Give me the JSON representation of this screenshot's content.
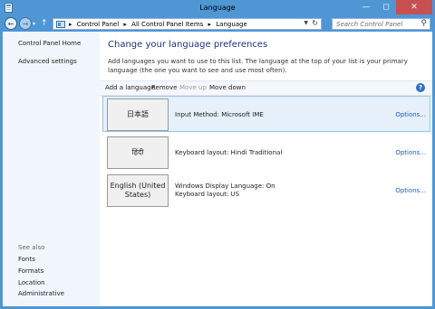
{
  "window": {
    "title": "Language"
  },
  "navigation": {
    "breadcrumbs": [
      "Control Panel",
      "All Control Panel Items",
      "Language"
    ],
    "search_placeholder": "Search Control Panel"
  },
  "sidebar": {
    "links": [
      "Control Panel Home",
      "Advanced settings"
    ],
    "see_also_label": "See also",
    "see_also": [
      "Fonts",
      "Formats",
      "Location",
      "Administrative"
    ]
  },
  "main": {
    "heading": "Change your language preferences",
    "description": "Add languages you want to use to this list. The language at the top of your list is your primary language (the one you want to see and use most often).",
    "toolbar": {
      "add": "Add a language",
      "remove": "Remove",
      "move_up": "Move up",
      "move_down": "Move down",
      "help": "?"
    },
    "languages": [
      {
        "tile": "日本語",
        "details": [
          "Input Method: Microsoft IME"
        ],
        "options": "Options..."
      },
      {
        "tile": "हिंदी",
        "details": [
          "Keyboard layout: Hindi Traditional"
        ],
        "options": "Options..."
      },
      {
        "tile": "English (United States)",
        "details": [
          "Windows Display Language: On",
          "Keyboard layout: US"
        ],
        "options": "Options..."
      }
    ]
  },
  "colors": {
    "frame": "#4f96d4",
    "close": "#c75050",
    "link": "#1e5bbf",
    "heading": "#1e3287"
  }
}
